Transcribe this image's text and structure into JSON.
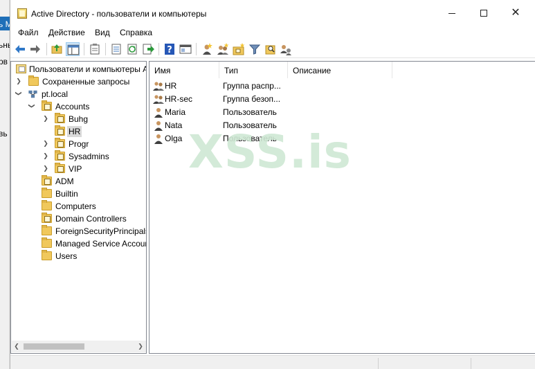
{
  "background_window": {
    "fragments": [
      "ь М",
      "ьнь",
      "рв",
      "вь"
    ]
  },
  "window": {
    "title": "Active Directory - пользователи и компьютеры",
    "controls": {
      "minimize": "minimize",
      "maximize": "maximize",
      "close": "✕"
    }
  },
  "menu": [
    "Файл",
    "Действие",
    "Вид",
    "Справка"
  ],
  "toolbar": {
    "buttons": [
      "back-icon",
      "forward-icon",
      "up-folder-icon",
      "show-tree-icon",
      "clipboard-icon",
      "list-icon",
      "refresh-icon",
      "export-icon",
      "help-icon",
      "console-icon",
      "new-user-icon",
      "new-group-icon",
      "new-ou-icon",
      "filter-icon",
      "find-icon",
      "delegate-icon"
    ]
  },
  "tree": {
    "root": "Пользователи и компьютеры Active Directory",
    "saved_queries": "Сохраненные запросы",
    "domain": "pt.local",
    "accounts": "Accounts",
    "accounts_children": [
      "Buhg",
      "HR",
      "Progr",
      "Sysadmins",
      "VIP"
    ],
    "selected": "HR",
    "domain_children": [
      "ADM",
      "Builtin",
      "Computers",
      "Domain Controllers",
      "ForeignSecurityPrincipals",
      "Managed Service Accounts",
      "Users"
    ]
  },
  "list": {
    "columns": [
      "Имя",
      "Тип",
      "Описание"
    ],
    "rows": [
      {
        "name": "HR",
        "type": "Группа распр...",
        "icon": "group-icon"
      },
      {
        "name": "HR-sec",
        "type": "Группа безоп...",
        "icon": "group-icon"
      },
      {
        "name": "Maria",
        "type": "Пользователь",
        "icon": "user-icon"
      },
      {
        "name": "Nata",
        "type": "Пользователь",
        "icon": "user-icon"
      },
      {
        "name": "Olga",
        "type": "Пользователь",
        "icon": "user-icon"
      }
    ]
  },
  "watermark": "XSS.is"
}
